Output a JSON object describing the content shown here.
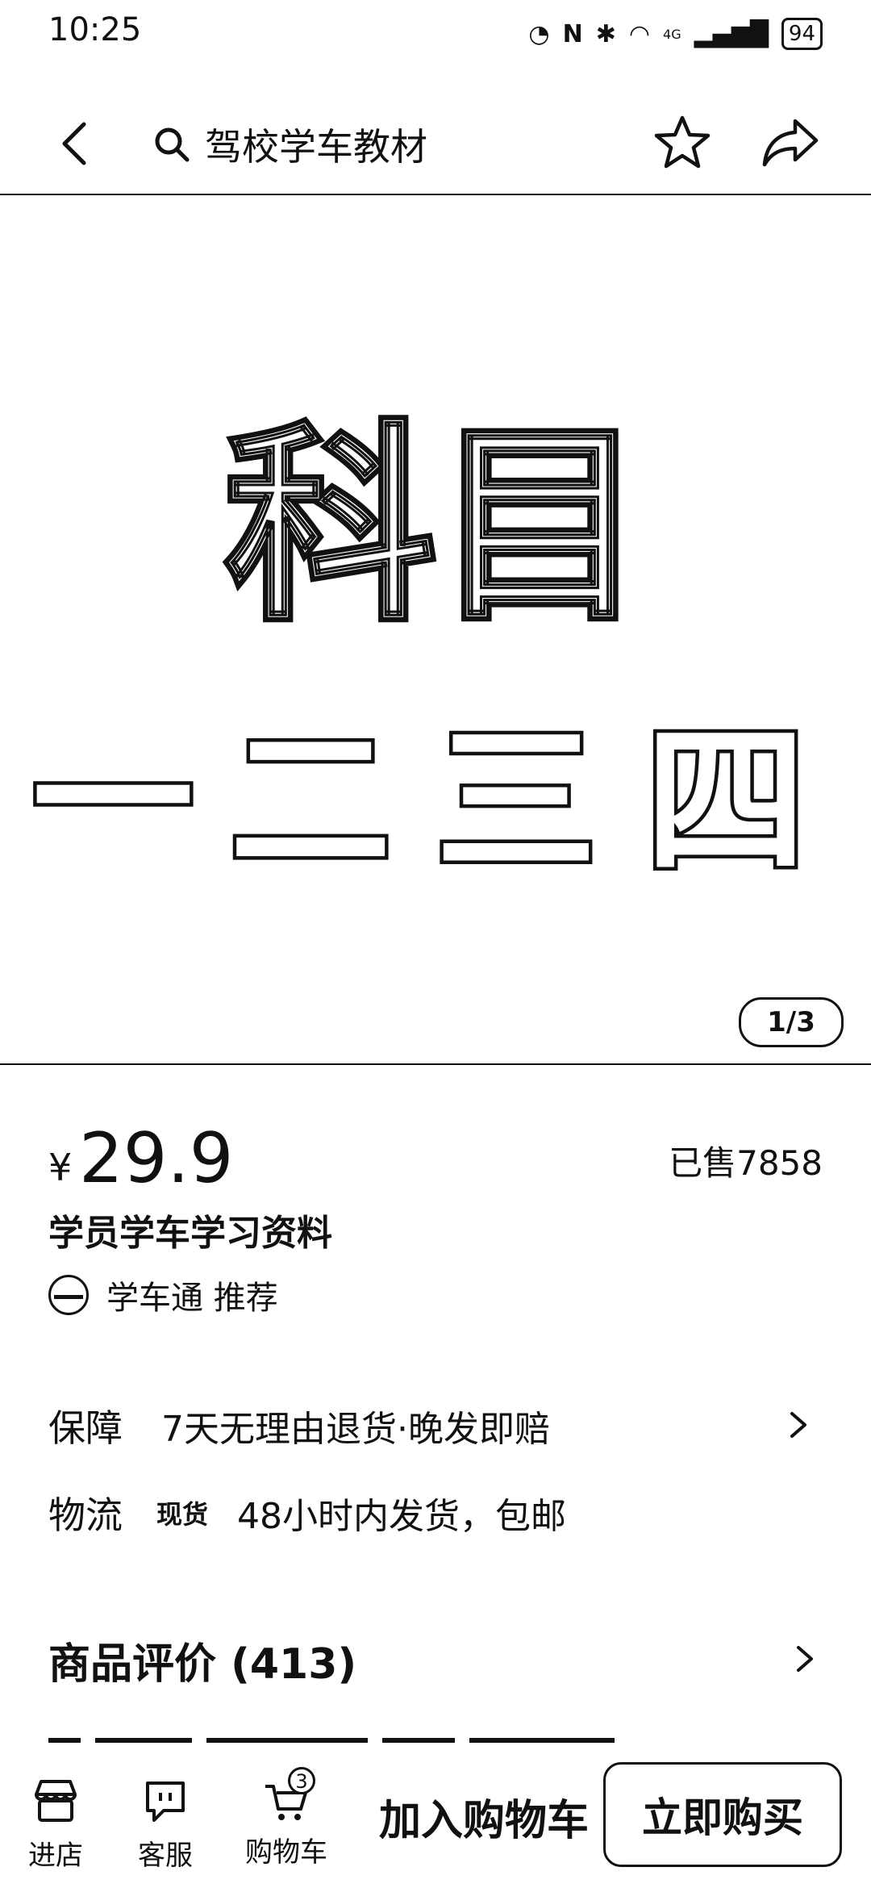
{
  "status_bar": {
    "time": "10:25",
    "network": "4G",
    "battery": "94"
  },
  "top_nav": {
    "search_query": "驾校学车教材"
  },
  "gallery": {
    "heading": "科目",
    "subjects": [
      "一",
      "二",
      "三",
      "四"
    ],
    "page_indicator": "1/3"
  },
  "product": {
    "currency": "¥",
    "price": "29.9",
    "sold": "已售7858",
    "title": "学员学车学习资料",
    "recommend": "学车通 推荐"
  },
  "guarantee": {
    "label": "保障",
    "text": "7天无理由退货·晚发即赔"
  },
  "logistics": {
    "label": "物流",
    "tag": "现货",
    "text": "48小时内发货，包邮"
  },
  "reviews": {
    "title": "商品评价 (413)"
  },
  "bottom_bar": {
    "store": "进店",
    "service": "客服",
    "cart": "购物车",
    "cart_count": "3",
    "add_to_cart": "加入购物车",
    "buy_now": "立即购买"
  }
}
